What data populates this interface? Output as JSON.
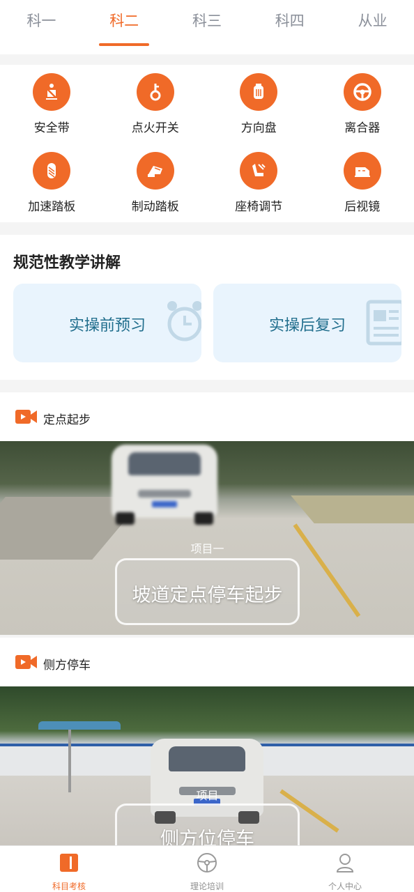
{
  "top_tabs": [
    "科一",
    "科二",
    "科三",
    "科四",
    "从业"
  ],
  "active_tab_index": 1,
  "controls": [
    {
      "label": "安全带",
      "icon": "seatbelt-icon"
    },
    {
      "label": "点火开关",
      "icon": "ignition-key-icon"
    },
    {
      "label": "方向盘",
      "icon": "steering-column-icon"
    },
    {
      "label": "离合器",
      "icon": "steering-wheel-icon"
    },
    {
      "label": "加速踏板",
      "icon": "accelerator-pedal-icon"
    },
    {
      "label": "制动踏板",
      "icon": "brake-pedal-icon"
    },
    {
      "label": "座椅调节",
      "icon": "seat-adjust-icon"
    },
    {
      "label": "后视镜",
      "icon": "mirror-icon"
    }
  ],
  "teaching": {
    "title": "规范性教学讲解",
    "cards": [
      {
        "label": "实操前预习",
        "icon": "alarm-clock-icon"
      },
      {
        "label": "实操后复习",
        "icon": "document-icon"
      }
    ]
  },
  "sections": [
    {
      "title": "定点起步",
      "project_tag": "项目一",
      "project_name": "坡道定点停车起步"
    },
    {
      "title": "侧方停车",
      "project_tag": "项目",
      "project_name": "侧方位停车"
    }
  ],
  "bottom_nav": [
    {
      "label": "科目考核",
      "icon": "exam-icon"
    },
    {
      "label": "理论培训",
      "icon": "steering-wheel-icon"
    },
    {
      "label": "个人中心",
      "icon": "person-icon"
    }
  ],
  "active_nav_index": 0,
  "colors": {
    "accent": "#f06a28",
    "card_bg": "#e9f4fd",
    "card_text": "#1f6d8c"
  }
}
